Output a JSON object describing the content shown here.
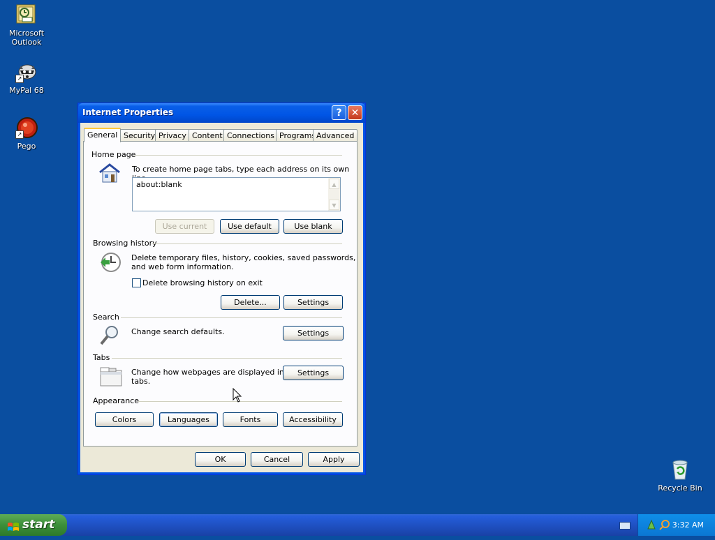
{
  "desktop": {
    "icons": [
      {
        "label_line1": "Microsoft",
        "label_line2": "Outlook"
      },
      {
        "label_line1": "MyPal 68",
        "label_line2": ""
      },
      {
        "label_line1": "Pego",
        "label_line2": ""
      },
      {
        "label_line1": "Recycle Bin",
        "label_line2": ""
      }
    ]
  },
  "dialog": {
    "title": "Internet Properties",
    "help_glyph": "?",
    "close_glyph": "✕",
    "tabs": [
      "General",
      "Security",
      "Privacy",
      "Content",
      "Connections",
      "Programs",
      "Advanced"
    ],
    "active_tab": "General",
    "home_page": {
      "group_label": "Home page",
      "description": "To create home page tabs, type each address on its own line.",
      "value": "about:blank",
      "use_current": "Use current",
      "use_default": "Use default",
      "use_blank": "Use blank"
    },
    "browsing_history": {
      "group_label": "Browsing history",
      "description_line1": "Delete temporary files, history, cookies, saved passwords,",
      "description_line2": "and web form information.",
      "checkbox_label": "Delete browsing history on exit",
      "checkbox_checked": false,
      "delete_button": "Delete...",
      "settings_button": "Settings"
    },
    "search": {
      "group_label": "Search",
      "description": "Change search defaults.",
      "settings_button": "Settings"
    },
    "tabs_section": {
      "group_label": "Tabs",
      "description_line1": "Change how webpages are displayed in",
      "description_line2": "tabs.",
      "settings_button": "Settings"
    },
    "appearance": {
      "group_label": "Appearance",
      "colors": "Colors",
      "languages": "Languages",
      "fonts": "Fonts",
      "accessibility": "Accessibility"
    },
    "footer": {
      "ok": "OK",
      "cancel": "Cancel",
      "apply": "Apply"
    }
  },
  "taskbar": {
    "start_label": "start",
    "clock": "3:32 AM"
  },
  "colors": {
    "desktop": "#0a4ea0",
    "titlebar": "#0055e5",
    "dialog_bg": "#ece9d8"
  }
}
